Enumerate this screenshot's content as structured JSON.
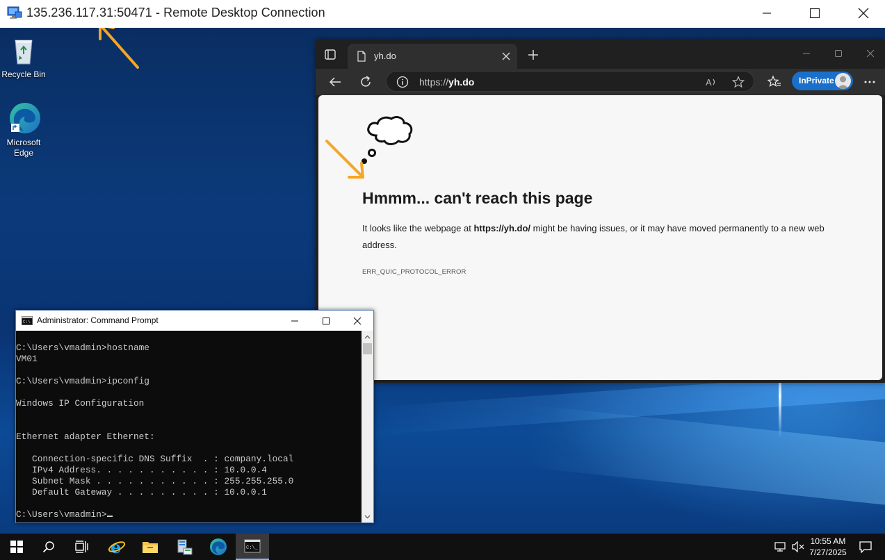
{
  "rdp": {
    "title": "135.236.117.31:50471 - Remote Desktop Connection"
  },
  "desktop": {
    "icons": [
      {
        "label": "Recycle Bin",
        "icon": "recycle-bin-icon"
      },
      {
        "label": "Microsoft Edge",
        "icon": "edge-icon"
      }
    ]
  },
  "edge": {
    "tab_title": "yh.do",
    "address": {
      "scheme": "https://",
      "host": "yh.do"
    },
    "inprivate_label": "InPrivate",
    "error": {
      "heading": "Hmmm... can't reach this page",
      "desc_prefix": "It looks like the webpage at ",
      "desc_url": "https://yh.do/",
      "desc_suffix": " might be having issues, or it may have moved permanently to a new web address.",
      "code": "ERR_QUIC_PROTOCOL_ERROR"
    }
  },
  "cmd": {
    "title": "Administrator: Command Prompt",
    "lines": [
      "C:\\Users\\vmadmin>hostname",
      "VM01",
      "",
      "C:\\Users\\vmadmin>ipconfig",
      "",
      "Windows IP Configuration",
      "",
      "",
      "Ethernet adapter Ethernet:",
      "",
      "   Connection-specific DNS Suffix  . : company.local",
      "   IPv4 Address. . . . . . . . . . . : 10.0.0.4",
      "   Subnet Mask . . . . . . . . . . . : 255.255.255.0",
      "   Default Gateway . . . . . . . . . : 10.0.0.1",
      "",
      "C:\\Users\\vmadmin>"
    ]
  },
  "taskbar": {
    "items": [
      "start-icon",
      "search-icon",
      "task-view-icon",
      "internet-explorer-icon",
      "file-explorer-icon",
      "server-manager-icon",
      "edge-icon",
      "command-prompt-icon"
    ],
    "clock_time": "10:55 AM",
    "clock_date": "7/27/2025"
  },
  "colors": {
    "annotation_arrow": "#f5a623",
    "inprivate_badge": "#1a6fc9",
    "taskbar": "#101010"
  }
}
